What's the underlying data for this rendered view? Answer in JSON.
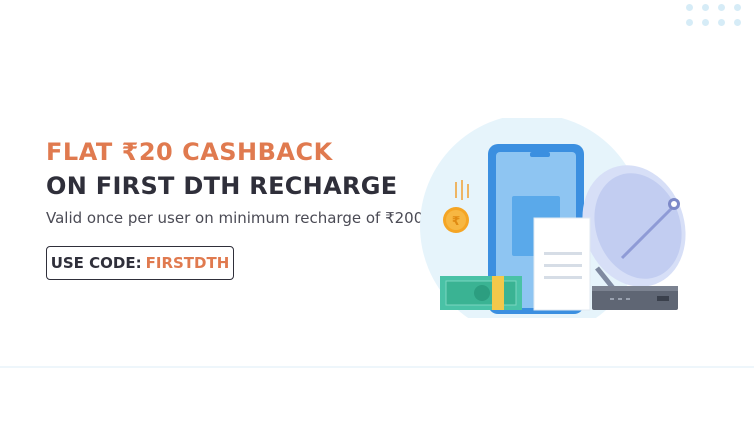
{
  "offer": {
    "headline": "FLAT ₹20 CASHBACK",
    "subheadline": "ON FIRST DTH RECHARGE",
    "description": "Valid once per user on minimum recharge of ₹200",
    "code_label": "USE CODE:",
    "code_value": "FIRSTDTH"
  },
  "colors": {
    "accent": "#e07a4f",
    "text_dark": "#2f2f3a",
    "illustration_blue": "#3b8fe0",
    "light_blue_bg": "#e6f4fb"
  },
  "icons": [
    "coin-rupee-icon",
    "phone-icon",
    "receipt-icon",
    "satellite-dish-icon",
    "cash-icon",
    "set-top-box-icon"
  ]
}
